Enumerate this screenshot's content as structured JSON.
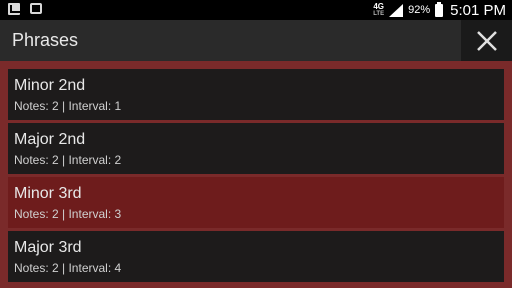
{
  "status_bar": {
    "network": "4G",
    "network_sub": "LTE",
    "battery": "92%",
    "time": "5:01 PM",
    "icons": [
      "chart-icon",
      "voicemail-icon",
      "signal-icon",
      "battery-icon"
    ]
  },
  "header": {
    "title": "Phrases",
    "close_icon": "close-icon"
  },
  "phrases": [
    {
      "name": "Minor 2nd",
      "details": "Notes: 2 | Interval: 1",
      "selected": false
    },
    {
      "name": "Major 2nd",
      "details": "Notes: 2 | Interval: 2",
      "selected": false
    },
    {
      "name": "Minor 3rd",
      "details": "Notes: 2 | Interval: 3",
      "selected": true
    },
    {
      "name": "Major 3rd",
      "details": "Notes: 2 | Interval: 4",
      "selected": false
    }
  ],
  "colors": {
    "accent": "#7a2a2a",
    "selected": "#6e1c1c",
    "item_bg": "#1d1b1b"
  }
}
